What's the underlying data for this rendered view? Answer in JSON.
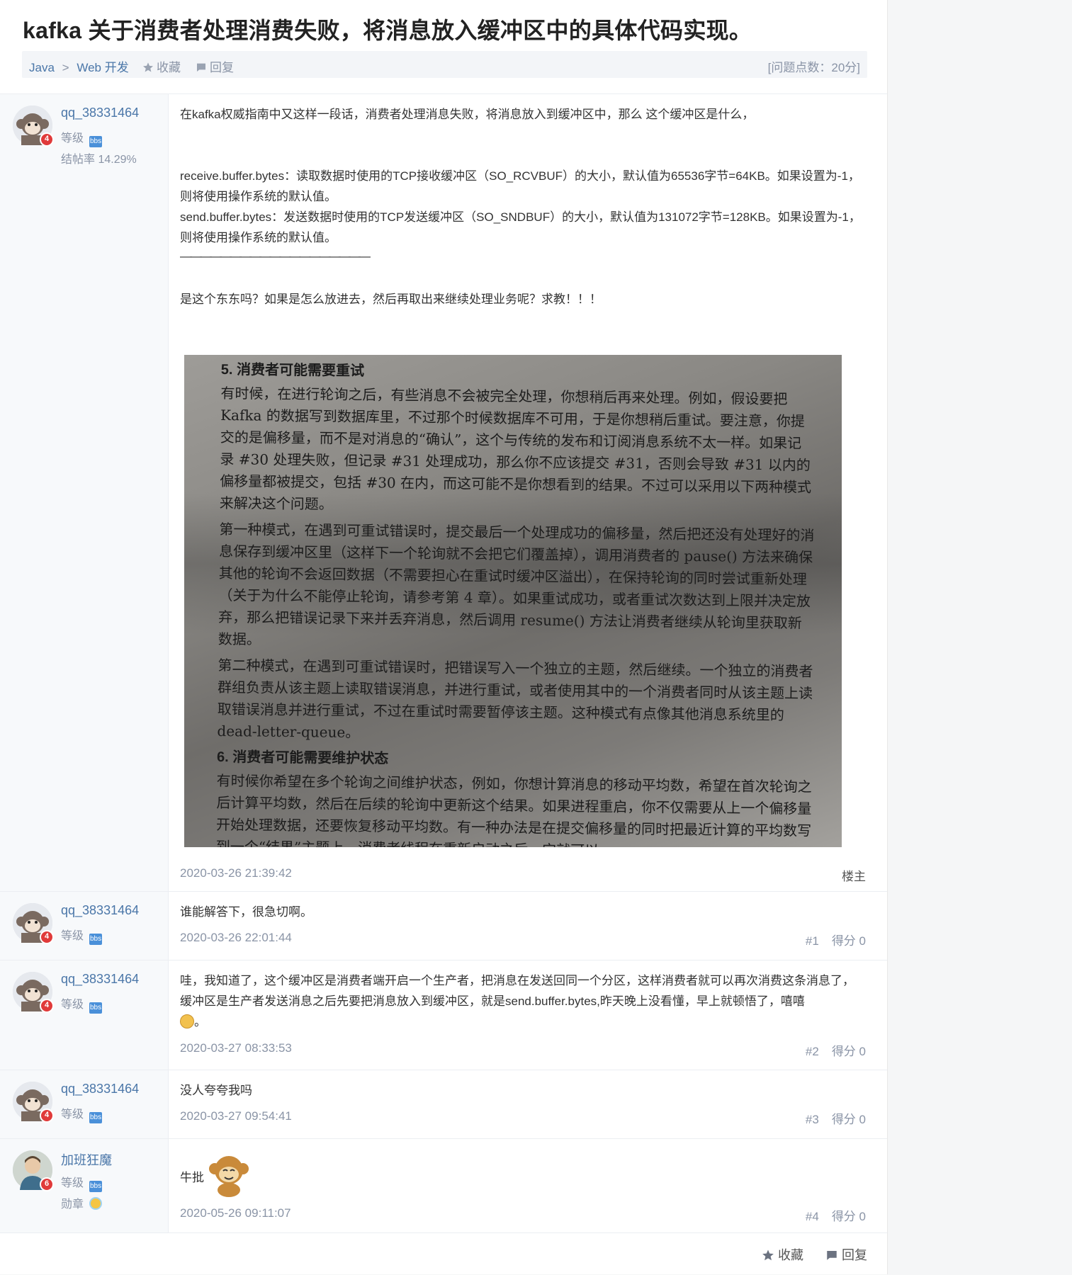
{
  "title": "kafka 关于消费者处理消费失败，将消息放入缓冲区中的具体代码实现。",
  "breadcrumb": {
    "parent": "Java",
    "separator": ">",
    "child": "Web 开发"
  },
  "meta": {
    "favorite_label": "收藏",
    "reply_label": "回复",
    "points": "[问题点数：20分]"
  },
  "op": {
    "username": "qq_38331464",
    "years_badge": "4",
    "level_label": "等级",
    "level_icon_text": "bbs",
    "stat": "结帖率 14.29%",
    "paragraphs": [
      "在kafka权威指南中又这样一段话，消费者处理消息失败，将消息放入到缓冲区中，那么 这个缓冲区是什么，",
      "receive.buffer.bytes：读取数据时使用的TCP接收缓冲区（SO_RCVBUF）的大小，默认值为65536字节=64KB。如果设置为-1，则将使用操作系统的默认值。",
      "send.buffer.bytes：发送数据时使用的TCP发送缓冲区（SO_SNDBUF）的大小，默认值为131072字节=128KB。如果设置为-1，则将使用操作系统的默认值。",
      "———————————————————",
      "是这个东东吗？如果是怎么放进去，然后再取出来继续处理业务呢？求教！！！"
    ],
    "time": "2020-03-26 21:39:42",
    "role": "楼主"
  },
  "photo": {
    "heading1": "5. 消费者可能需要重试",
    "para1": "有时候，在进行轮询之后，有些消息不会被完全处理，你想稍后再来处理。例如，假设要把 Kafka 的数据写到数据库里，不过那个时候数据库不可用，于是你想稍后重试。要注意，你提交的是偏移量，而不是对消息的“确认”，这个与传统的发布和订阅消息系统不太一样。如果记录 #30 处理失败，但记录 #31 处理成功，那么你不应该提交 #31，否则会导致 #31 以内的偏移量都被提交，包括 #30 在内，而这可能不是你想看到的结果。不过可以采用以下两种模式来解决这个问题。",
    "para2": "第一种模式，在遇到可重试错误时，提交最后一个处理成功的偏移量，然后把还没有处理好的消息保存到缓冲区里（这样下一个轮询就不会把它们覆盖掉），调用消费者的 pause() 方法来确保其他的轮询不会返回数据（不需要担心在重试时缓冲区溢出），在保持轮询的同时尝试重新处理（关于为什么不能停止轮询，请参考第 4 章）。如果重试成功，或者重试次数达到上限并决定放弃，那么把错误记录下来并丢弃消息，然后调用 resume() 方法让消费者继续从轮询里获取新数据。",
    "para3": "第二种模式，在遇到可重试错误时，把错误写入一个独立的主题，然后继续。一个独立的消费者群组负责从该主题上读取错误消息，并进行重试，或者使用其中的一个消费者同时从该主题上读取错误消息并进行重试，不过在重试时需要暂停该主题。这种模式有点像其他消息系统里的 dead-letter-queue。",
    "heading2": "6. 消费者可能需要维护状态",
    "para4": "有时候你希望在多个轮询之间维护状态，例如，你想计算消息的移动平均数，希望在首次轮询之后计算平均数，然后在后续的轮询中更新这个结果。如果进程重启，你不仅需要从上一个偏移量开始处理数据，还要恢复移动平均数。有一种办法是在提交偏移量的同时把最近计算的平均数写到一个“结果”主题上。消费者线程在重新启动之后，它就可以"
  },
  "replies": [
    {
      "username": "qq_38331464",
      "years_badge": "4",
      "level_label": "等级",
      "text": "谁能解答下，很急切啊。",
      "time": "2020-03-26 22:01:44",
      "floor": "#1",
      "score": "得分 0"
    },
    {
      "username": "qq_38331464",
      "years_badge": "4",
      "level_label": "等级",
      "text": "哇，我知道了，这个缓冲区是消费者端开启一个生产者，把消息在发送回同一个分区，这样消费者就可以再次消费这条消息了，缓冲区是生产者发送消息之后先要把消息放入到缓冲区，就是send.buffer.bytes,昨天晚上没看懂，早上就顿悟了，嘻嘻",
      "text_suffix": "。",
      "time": "2020-03-27 08:33:53",
      "floor": "#2",
      "score": "得分 0"
    },
    {
      "username": "qq_38331464",
      "years_badge": "4",
      "level_label": "等级",
      "text": "没人夸夸我吗",
      "time": "2020-03-27 09:54:41",
      "floor": "#3",
      "score": "得分 0"
    },
    {
      "username": "加班狂魔",
      "years_badge": "6",
      "level_label": "等级",
      "medal_label": "勋章",
      "text": "牛批",
      "time": "2020-05-26 09:11:07",
      "floor": "#4",
      "score": "得分 0"
    }
  ],
  "bottom": {
    "favorite_label": "收藏",
    "reply_label": "回复"
  },
  "colors": {
    "link": "#4a76a8",
    "muted": "#8a94a6",
    "badge": "#e03a3a"
  }
}
